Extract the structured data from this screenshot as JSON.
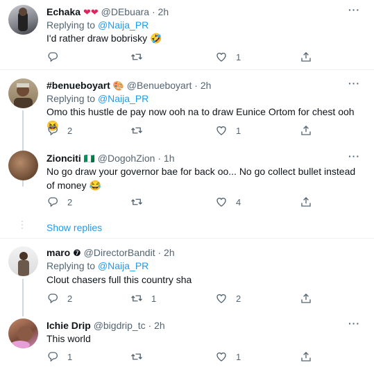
{
  "replying_prefix": "Replying to",
  "tweets": [
    {
      "name": "Echaka",
      "name_emoji": "❤❤",
      "handle": "@DEbuara",
      "time": "2h",
      "replying_to": "@Naija_PR",
      "text": "I'd rather draw bobrisky 🤣",
      "replies": "",
      "retweets": "",
      "likes": "1"
    },
    {
      "name": "#benueboyart",
      "name_emoji": "🎨",
      "handle": "@Benueboyart",
      "time": "2h",
      "replying_to": "@Naija_PR",
      "text": "Omo this hustle de pay now ooh na to draw Eunice Ortom for chest ooh😆",
      "replies": "2",
      "retweets": "",
      "likes": "1"
    },
    {
      "name": "Zionciti",
      "name_emoji": "🇳🇬",
      "handle": "@DogohZion",
      "time": "1h",
      "text": "No go draw your governor bae for back oo... No go collect bullet instead of money 😂",
      "replies": "2",
      "retweets": "",
      "likes": "4"
    },
    {
      "name": "maro",
      "name_emoji": "❼",
      "handle": "@DirectorBandit",
      "time": "2h",
      "replying_to": "@Naija_PR",
      "text": "Clout chasers full this country sha",
      "replies": "2",
      "retweets": "1",
      "likes": "2"
    },
    {
      "name": "Ichie Drip",
      "handle": "@bigdrip_tc",
      "time": "2h",
      "text": "This world",
      "replies": "1",
      "retweets": "",
      "likes": "1"
    }
  ],
  "show_replies": "Show replies",
  "more_glyph": "···",
  "dot": "·",
  "icons": [
    "reply-icon",
    "retweet-icon",
    "like-icon",
    "share-icon",
    "more-icon"
  ]
}
